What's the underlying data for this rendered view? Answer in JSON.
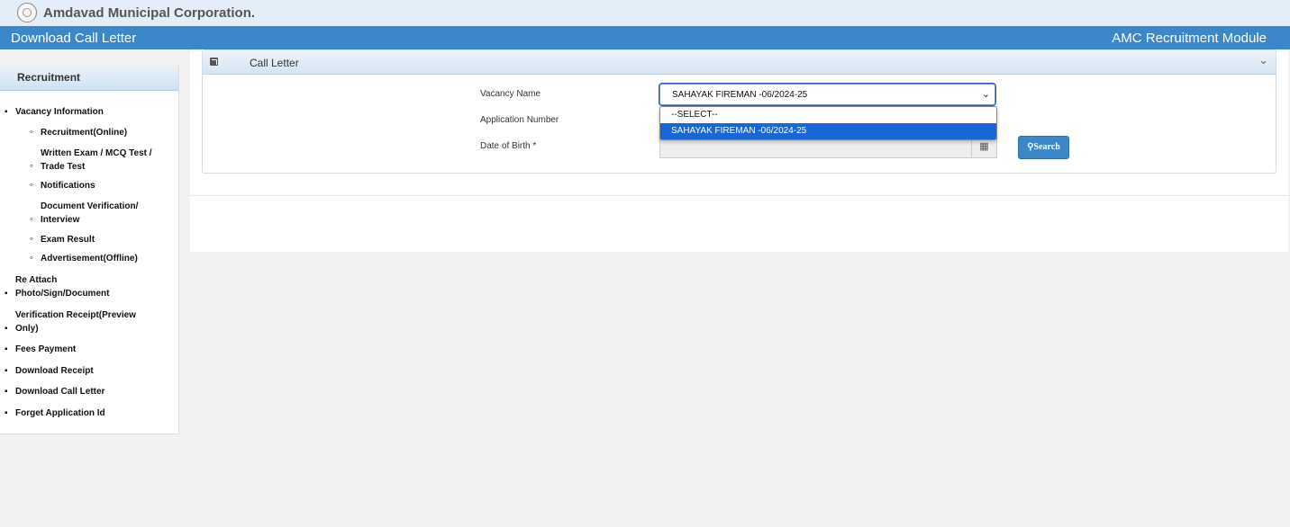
{
  "header": {
    "org_name": "Amdavad Municipal Corporation.",
    "page_title": "Download Call Letter",
    "module_name": "AMC Recruitment Module"
  },
  "sidebar": {
    "title": "Recruitment",
    "items": [
      {
        "label": "Vacancy Information"
      },
      {
        "label": "Recruitment(Online)"
      },
      {
        "label": "Written Exam / MCQ Test / Trade Test"
      },
      {
        "label": "Notifications"
      },
      {
        "label": "Document Verification/ Interview"
      },
      {
        "label": "Exam Result"
      },
      {
        "label": "Advertisement(Offline)"
      },
      {
        "label": "Re Attach Photo/Sign/Document"
      },
      {
        "label": "Verification Receipt(Preview Only)"
      },
      {
        "label": "Fees Payment"
      },
      {
        "label": "Download Receipt"
      },
      {
        "label": "Download Call Letter"
      },
      {
        "label": "Forget Application Id"
      }
    ]
  },
  "panel": {
    "title": "Call Letter",
    "toggle_icon": "chevron-down-icon"
  },
  "form": {
    "vacancy_label": "Vacancy Name",
    "vacancy_value": "SAHAYAK FIREMAN -06/2024-25",
    "vacancy_options": [
      "--SELECT--",
      "SAHAYAK FIREMAN -06/2024-25"
    ],
    "application_label": "Application Number",
    "dob_label": "Date of Birth *",
    "search_label": "Search"
  },
  "colors": {
    "header_blue": "#3b87c9",
    "selected_option": "#1a66d4"
  }
}
